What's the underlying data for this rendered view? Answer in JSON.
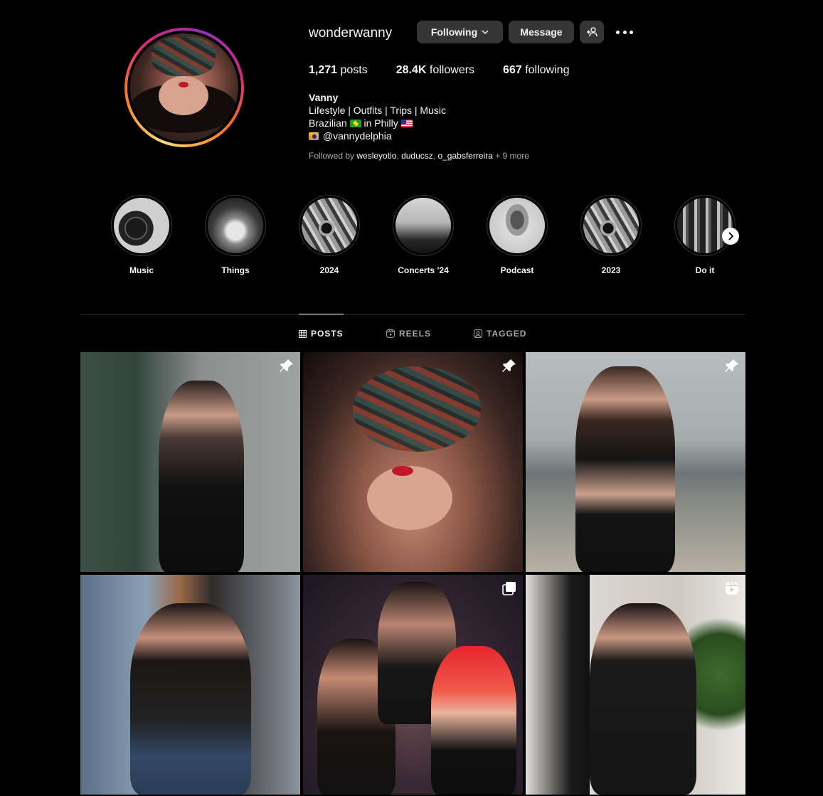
{
  "profile": {
    "username": "wonderwanny",
    "buttons": {
      "following": "Following",
      "message": "Message"
    },
    "stats": {
      "posts_count": "1,271",
      "posts_label": "posts",
      "followers_count": "28.4K",
      "followers_label": "followers",
      "following_count": "667",
      "following_label": "following"
    },
    "bio": {
      "name": "Vanny",
      "line1": "Lifestyle | Outfits | Trips | Music",
      "line2_a": "Brazilian",
      "line2_b": "in Philly",
      "line3": "@vannydelphia"
    },
    "followed_by": {
      "prefix": "Followed by",
      "users": [
        "wesleyotio",
        "duducsz",
        "o_gabsferreira"
      ],
      "suffix": "+ 9 more"
    }
  },
  "highlights": [
    {
      "label": "Music",
      "icon": "turntable-image"
    },
    {
      "label": "Things",
      "icon": "hands-image"
    },
    {
      "label": "2024",
      "icon": "collage-image"
    },
    {
      "label": "Concerts '24",
      "icon": "crowd-image"
    },
    {
      "label": "Podcast",
      "icon": "microphone-image"
    },
    {
      "label": "2023",
      "icon": "collage-image"
    },
    {
      "label": "Do it",
      "icon": "dumbbells-image"
    }
  ],
  "tabs": [
    {
      "label": "POSTS",
      "icon": "grid-icon",
      "active": true
    },
    {
      "label": "REELS",
      "icon": "reels-icon",
      "active": false
    },
    {
      "label": "TAGGED",
      "icon": "tagged-icon",
      "active": false
    }
  ],
  "posts": [
    {
      "badge": "pin-icon"
    },
    {
      "badge": "pin-icon"
    },
    {
      "badge": "pin-icon"
    },
    {
      "badge": "none"
    },
    {
      "badge": "carousel-icon"
    },
    {
      "badge": "reel-icon"
    }
  ],
  "colors": {
    "background": "#000000",
    "button": "#363636",
    "muted_text": "#a8a8a8",
    "divider": "#262626"
  }
}
